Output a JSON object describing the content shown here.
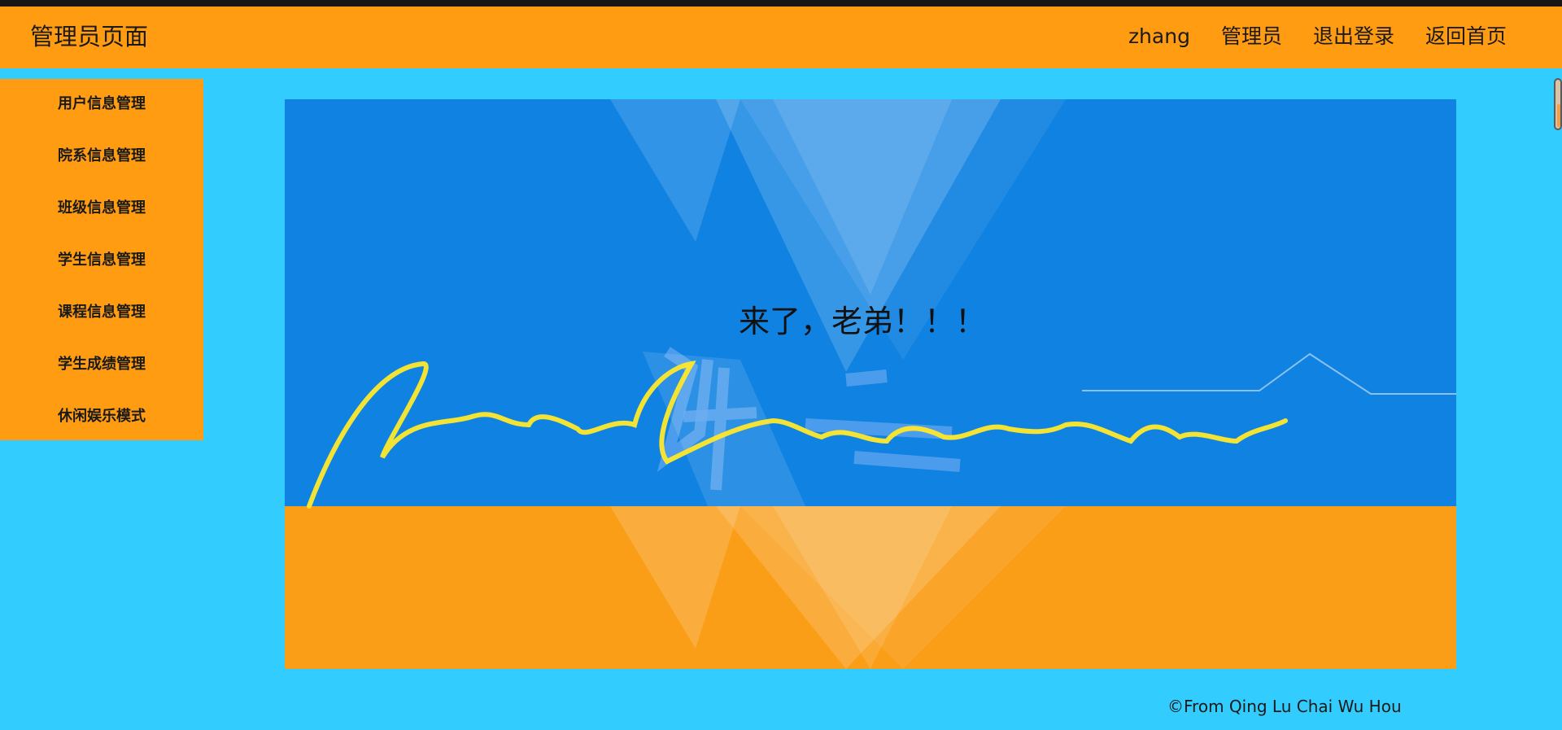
{
  "header": {
    "title": "管理员页面",
    "nav": [
      "zhang",
      "管理员",
      "退出登录",
      "返回首页"
    ]
  },
  "sidebar": {
    "items": [
      "用户信息管理",
      "院系信息管理",
      "班级信息管理",
      "学生信息管理",
      "课程信息管理",
      "学生成绩管理",
      "休闲娱乐模式"
    ]
  },
  "banner": {
    "greeting": "来了，老弟！！！"
  },
  "footer": {
    "copyright": "©From Qing Lu Chai Wu Hou"
  },
  "colors": {
    "background": "#33ccff",
    "header": "#ff9c12",
    "banner_blue": "#0f82e2",
    "banner_orange": "#fa9e17",
    "signature": "#ffe82a"
  }
}
